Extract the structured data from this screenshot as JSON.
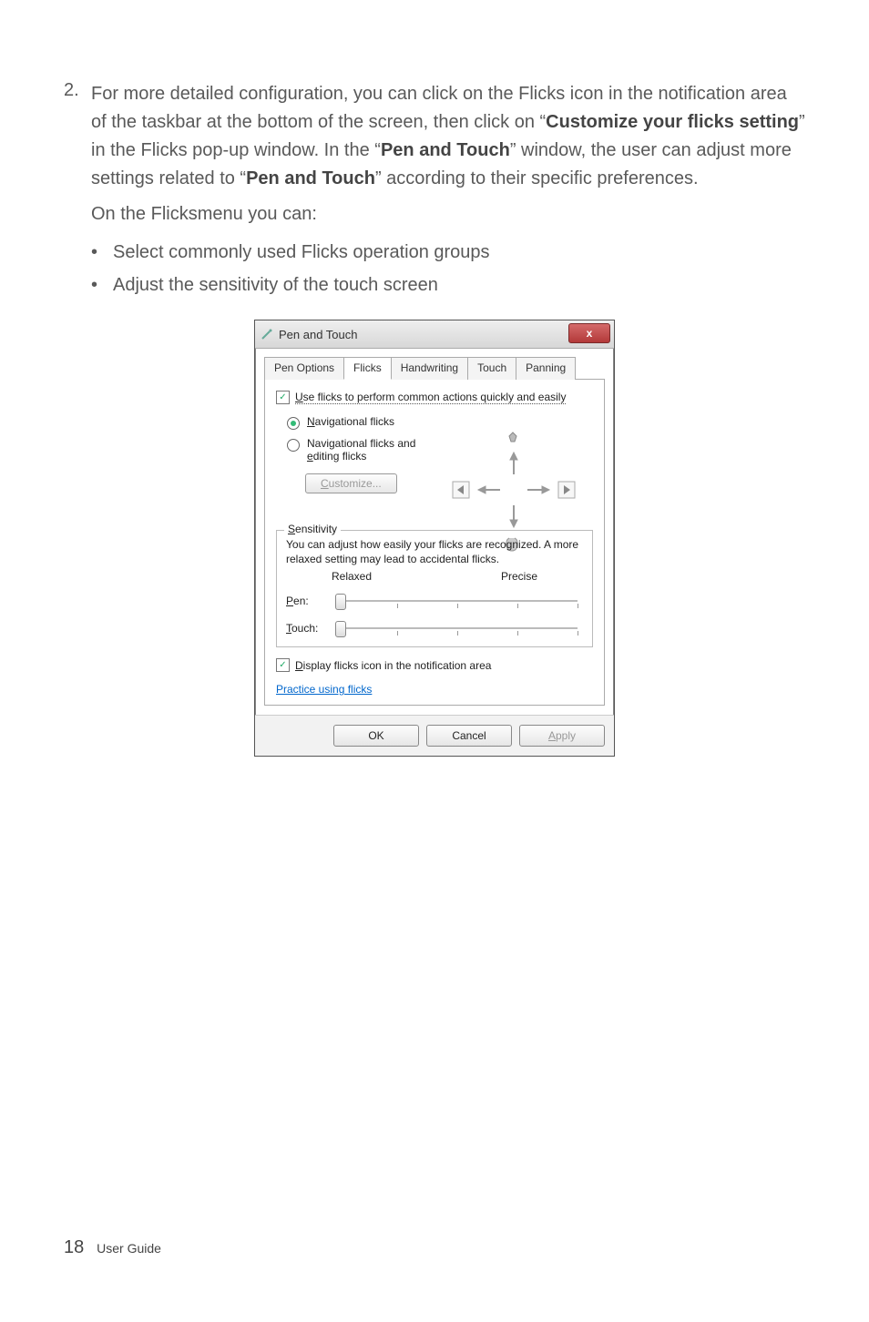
{
  "list_number": "2.",
  "para1_a": "For more detailed configuration, you can click on the Flicks icon in the notification area of the taskbar at the bottom of the screen, then click on “",
  "para1_b": "Customize your flicks setting",
  "para1_c": "” in the Flicks pop-up window. In the “",
  "para1_d": "Pen and Touch",
  "para1_e": "” window, the user can adjust more settings related to “",
  "para1_f": "Pen and Touch",
  "para1_g": "” according to their specific preferences.",
  "para2": "On the Flicksmenu you can:",
  "bullets": [
    "Select commonly used Flicks operation groups",
    "Adjust the sensitivity of the touch screen"
  ],
  "dialog": {
    "title": "Pen and Touch",
    "close": "x",
    "tabs": [
      "Pen Options",
      "Flicks",
      "Handwriting",
      "Touch",
      "Panning"
    ],
    "active_tab": 1,
    "use_flicks_pre": "U",
    "use_flicks_rest": "se flicks to perform common actions quickly and easily",
    "radio1_pre": "N",
    "radio1_rest": "avigational flicks",
    "radio2_line1": "Navigational flicks and",
    "radio2_pre": "e",
    "radio2_rest": "diting flicks",
    "customize_pre": "C",
    "customize_rest": "ustomize...",
    "sensitivity_legend_pre": "S",
    "sensitivity_legend_rest": "ensitivity",
    "sensitivity_desc": "You can adjust how easily your flicks are recognized. A more relaxed setting may lead to accidental flicks.",
    "relaxed": "Relaxed",
    "precise": "Precise",
    "pen_pre": "P",
    "pen_rest": "en:",
    "touch_pre": "T",
    "touch_rest": "ouch:",
    "display_pre": "D",
    "display_rest": "isplay flicks icon in the notification area",
    "practice": "Practice using flicks",
    "ok": "OK",
    "cancel": "Cancel",
    "apply_pre": "A",
    "apply_rest": "pply"
  },
  "footer": {
    "page": "18",
    "label": "User Guide"
  }
}
